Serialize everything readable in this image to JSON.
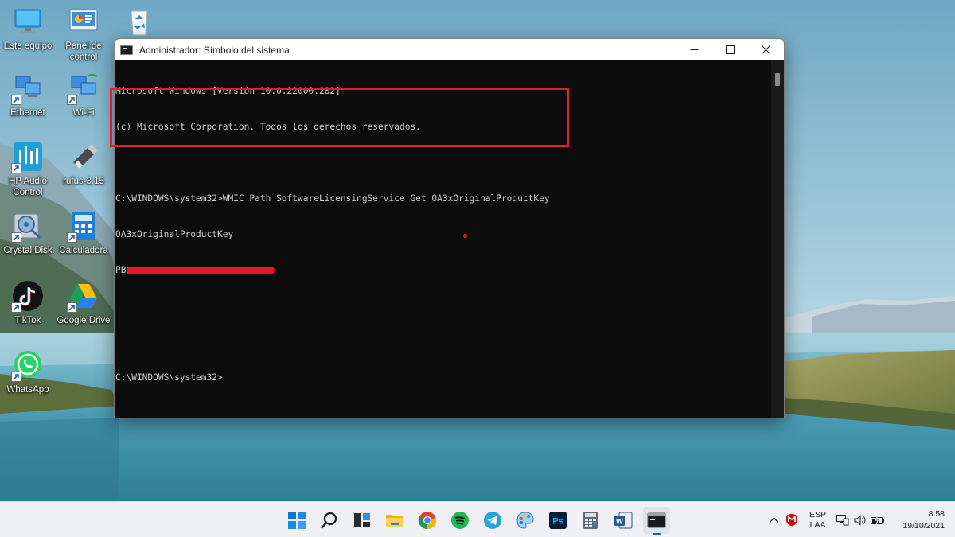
{
  "desktop": {
    "icons": [
      {
        "label": "Este equipo"
      },
      {
        "label": "Panel de control"
      },
      {
        "label": ""
      },
      {
        "label": "Ethernet"
      },
      {
        "label": "Wi-Fi"
      },
      {
        "label": "HP Audio Control"
      },
      {
        "label": "rufus-3.15"
      },
      {
        "label": "Crystal Disk"
      },
      {
        "label": "Calculadora"
      },
      {
        "label": "TikTok"
      },
      {
        "label": "Google Drive"
      },
      {
        "label": "WhatsApp"
      }
    ]
  },
  "window": {
    "title": "Administrador: Símbolo del sistema",
    "lines": [
      "Microsoft Windows [Versión 10.0.22000.282]",
      "(c) Microsoft Corporation. Todos los derechos reservados.",
      "",
      "C:\\WINDOWS\\system32>WMIC Path SoftwareLicensingService Get OA3xOriginalProductKey",
      "OA3xOriginalProductKey",
      "PB",
      "",
      "",
      "C:\\WINDOWS\\system32>"
    ],
    "highlight_color": "#e01e2e"
  },
  "taskbar": {
    "apps": [
      "start-icon",
      "search-icon",
      "task-view-icon",
      "file-explorer-icon",
      "chrome-icon",
      "spotify-icon",
      "telegram-icon",
      "paint-icon",
      "photoshop-icon",
      "calculator-icon",
      "word-icon",
      "terminal-icon"
    ],
    "photoshop_label": "Ps",
    "word_label": "W",
    "language_top": "ESP",
    "language_bottom": "LAA",
    "time": "8:58",
    "date": "19/10/2021",
    "accent": "#0067c0"
  }
}
